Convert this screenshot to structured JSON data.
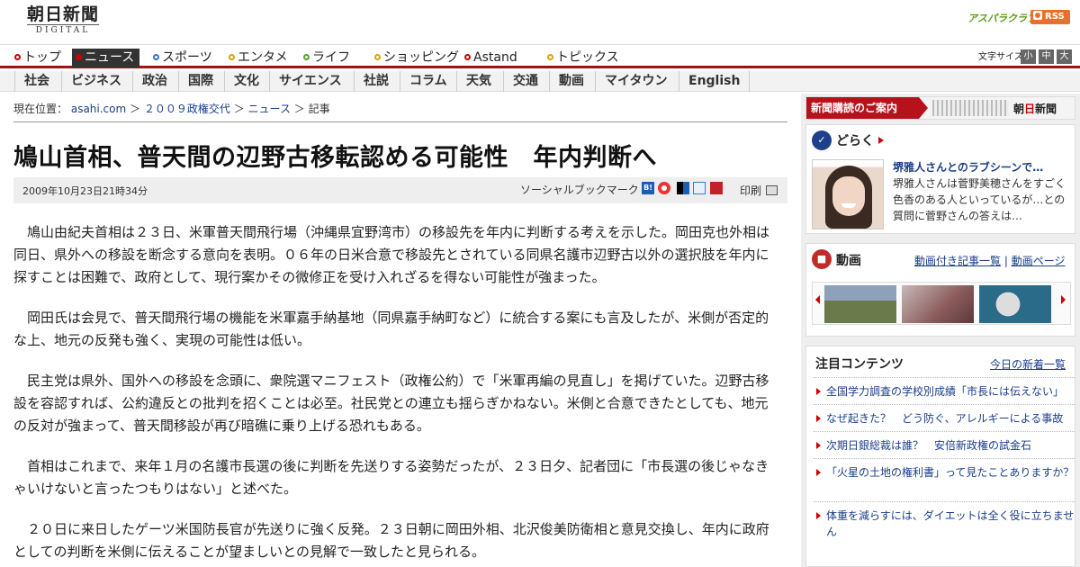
{
  "header": {
    "logo_jp": "朝日新聞",
    "logo_en": "DIGITAL",
    "asupara": "アスパラクラブ",
    "rss": "RSS"
  },
  "nav": {
    "items": [
      {
        "label": "トップ",
        "color": "#cc0000"
      },
      {
        "label": "ニュース",
        "color": "#cc0000"
      },
      {
        "label": "スポーツ",
        "color": "#3a6fc4"
      },
      {
        "label": "エンタメ",
        "color": "#d9a400"
      },
      {
        "label": "ライフ",
        "color": "#5aa02c"
      },
      {
        "label": "ショッピング",
        "color": "#d9a400"
      },
      {
        "label": "Astand",
        "color": "#cc0000"
      },
      {
        "label": "トピックス",
        "color": "#d9a400"
      }
    ],
    "fontsize_label": "文字サイズ",
    "fontsize_small": "小",
    "fontsize_medium": "中",
    "fontsize_large": "大"
  },
  "subnav": {
    "items": [
      "社会",
      "ビジネス",
      "政治",
      "国際",
      "文化",
      "サイエンス",
      "社説",
      "コラム",
      "天気",
      "交通",
      "動画",
      "マイタウン",
      "English"
    ]
  },
  "breadcrumb": {
    "prefix": "現在位置：",
    "items": [
      "asahi.com",
      "２００９政権交代",
      "ニュース"
    ],
    "separator": "＞",
    "current": "記事"
  },
  "article": {
    "headline": "鳩山首相、普天間の辺野古移転認める可能性　年内判断へ",
    "date": "2009年10月23日21時34分",
    "social_label": "ソーシャルブックマーク",
    "print_label": "印刷",
    "paragraphs": [
      "鳩山由紀夫首相は２３日、米軍普天間飛行場（沖縄県宜野湾市）の移設先を年内に判断する考えを示した。岡田克也外相は同日、県外への移設を断念する意向を表明。０６年の日米合意で移設先とされている同県名護市辺野古以外の選択肢を年内に探すことは困難で、政府として、現行案かその微修正を受け入れざるを得ない可能性が強まった。",
      "岡田氏は会見で、普天間飛行場の機能を米軍嘉手納基地（同県嘉手納町など）に統合する案にも言及したが、米側が否定的な上、地元の反発も強く、実現の可能性は低い。",
      "民主党は県外、国外への移設を念頭に、衆院選マニフェスト（政権公約）で「米軍再編の見直し」を掲げていた。辺野古移設を容認すれば、公約違反との批判を招くことは必至。社民党との連立も揺らぎかねない。米側と合意できたとしても、地元の反対が強まって、普天間移設が再び暗礁に乗り上げる恐れもある。",
      "首相はこれまで、来年１月の名護市長選の後に判断を先送りする姿勢だったが、２３日夕、記者団に「市長選の後じゃなきゃいけないと言ったつもりはない」と述べた。",
      "２０日に来日したゲーツ米国防長官が先送りに強く反発。２３日朝に岡田外相、北沢俊美防衛相と意見交換し、年内に政府としての判断を米側に伝えることが望ましいとの見解で一致したと見られる。"
    ]
  },
  "sidebar": {
    "ad_text": "新聞購読のご案内",
    "ad_logo_a": "朝",
    "ad_logo_b": "日",
    "ad_logo_c": "新聞",
    "doraku": {
      "title": "どらく",
      "link": "堺雅人さんとのラブシーンで…",
      "text": "堺雅人さんは菅野美穂さんをすごく色香のある人といっているが…との質問に菅野さんの答えは…"
    },
    "video": {
      "title": "動画",
      "link1": "動画付き記事一覧",
      "sep": "|",
      "link2": "動画ページ"
    },
    "attention": {
      "title": "注目コンテンツ",
      "more": "今日の新着一覧",
      "items": [
        "全国学力調査の学校別成績「市長には伝えない」",
        "なぜ起きた？　どう防ぐ、アレルギーによる事故",
        "次期日銀総裁は誰？　安倍新政権の試金石",
        "「火星の土地の権利書」って見たことありますか？",
        "体重を減らすには、ダイエットは全く役に立ちません"
      ]
    }
  }
}
